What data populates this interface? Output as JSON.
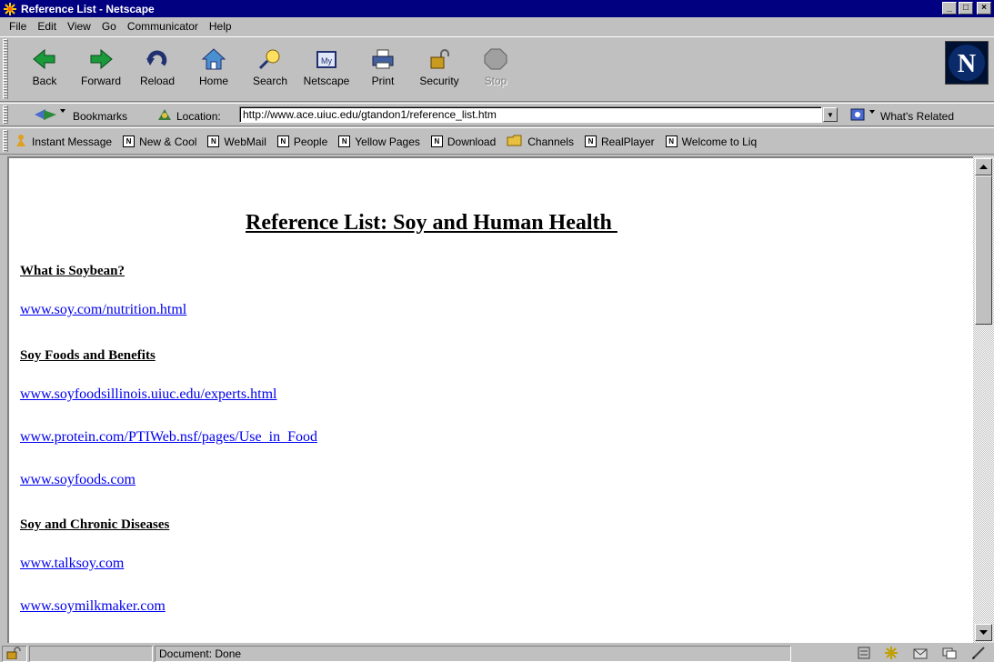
{
  "window": {
    "title": "Reference List - Netscape",
    "controls": [
      "_",
      "□",
      "×"
    ]
  },
  "menubar": {
    "items": [
      "File",
      "Edit",
      "View",
      "Go",
      "Communicator",
      "Help"
    ]
  },
  "toolbar": {
    "buttons": [
      {
        "label": "Back",
        "icon": "back-arrow-icon"
      },
      {
        "label": "Forward",
        "icon": "forward-arrow-icon"
      },
      {
        "label": "Reload",
        "icon": "reload-icon"
      },
      {
        "label": "Home",
        "icon": "home-icon"
      },
      {
        "label": "Search",
        "icon": "search-icon"
      },
      {
        "label": "Netscape",
        "icon": "netscape-my-icon"
      },
      {
        "label": "Print",
        "icon": "printer-icon"
      },
      {
        "label": "Security",
        "icon": "padlock-icon"
      },
      {
        "label": "Stop",
        "icon": "stop-icon",
        "disabled": true
      }
    ],
    "logo_letter": "N"
  },
  "location_bar": {
    "bookmarks_label": "Bookmarks",
    "location_label": "Location:",
    "url": "http://www.ace.uiuc.edu/gtandon1/reference_list.htm",
    "whats_related_label": "What's Related"
  },
  "personal_toolbar": {
    "items": [
      "Instant Message",
      "New & Cool",
      "WebMail",
      "People",
      "Yellow Pages",
      "Download",
      "Channels",
      "RealPlayer",
      "Welcome to Liq"
    ]
  },
  "page": {
    "title": "Reference List: Soy and Human Health ",
    "sections": [
      {
        "heading": "What is Soybean?",
        "links": [
          "www.soy.com/nutrition.html"
        ]
      },
      {
        "heading": "Soy Foods and Benefits",
        "links": [
          "www.soyfoodsillinois.uiuc.edu/experts.html",
          "www.protein.com/PTIWeb.nsf/pages/Use_in_Food",
          "www.soyfoods.com"
        ]
      },
      {
        "heading": "Soy and Chronic Diseases",
        "links": [
          "www.talksoy.com",
          "www.soymilkmaker.com"
        ]
      }
    ]
  },
  "status_bar": {
    "text": "Document: Done"
  },
  "colors": {
    "titlebar": "#000080",
    "chrome": "#c0c0c0",
    "link": "#0000ee"
  }
}
